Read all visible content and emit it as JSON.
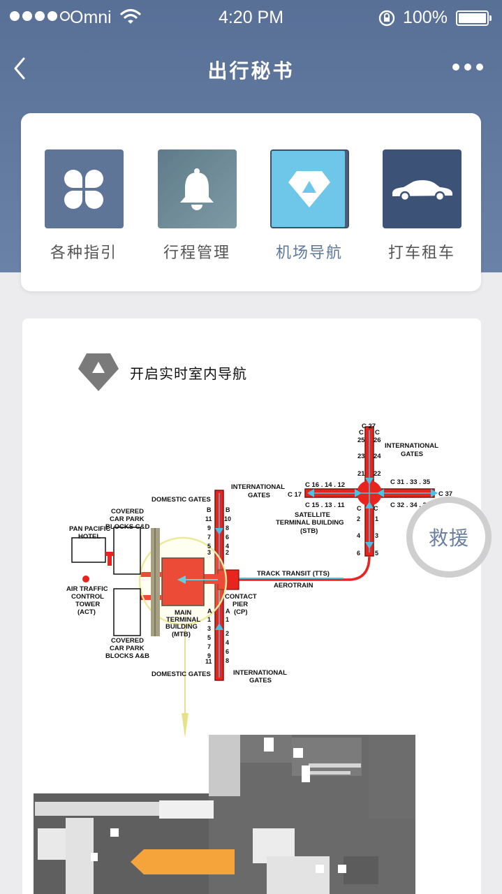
{
  "status_bar": {
    "carrier": "Omni",
    "time": "4:20 PM",
    "battery": "100%"
  },
  "nav": {
    "title": "出行秘书",
    "back_icon": "chevron-left-icon",
    "more_icon": "more-dots-icon"
  },
  "menu": [
    {
      "label": "各种指引",
      "icon": "clover-icon",
      "active": false
    },
    {
      "label": "行程管理",
      "icon": "bell-icon",
      "active": false
    },
    {
      "label": "机场导航",
      "icon": "diamond-icon",
      "active": true
    },
    {
      "label": "打车租车",
      "icon": "car-icon",
      "active": false
    }
  ],
  "indoor_nav": {
    "label": "开启实时室内导航",
    "icon": "diamond-icon"
  },
  "map": {
    "labels": {
      "c27": "C 27",
      "c25": "25",
      "c26": "26",
      "c23": "23",
      "c24": "24",
      "c21": "21",
      "c22": "22",
      "c_left": "C",
      "c_right": "C",
      "intl_gates_top": "INTERNATIONAL",
      "intl_gates_top2": "GATES",
      "c16": "C 16 . 14 . 12",
      "c17": "C 17",
      "c15": "C 15 . 13 . 11",
      "c31": "C 31 . 33 . 35",
      "c37": "C 37",
      "c32": "C 32 . 34 . 36",
      "satellite1": "SATELLITE",
      "satellite2": "TERMINAL BUILDING",
      "satellite3": "(STB)",
      "intl_mid1": "INTERNATIONAL",
      "intl_mid2": "GATES",
      "domestic_top": "DOMESTIC GATES",
      "covered_cd1": "COVERED",
      "covered_cd2": "CAR PARK",
      "covered_cd3": "BLOCKS C&D",
      "pan1": "PAN PACIFIC",
      "pan2": "HOTEL",
      "atc1": "AIR TRAFFIC",
      "atc2": "CONTROL",
      "atc3": "TOWER",
      "atc4": "(ACT)",
      "track": "TRACK TRANSIT (TTS)",
      "aerotrain": "AEROTRAIN",
      "contact1": "CONTACT",
      "contact2": "PIER",
      "contact3": "(CP)",
      "main1": "MAIN",
      "main2": "TERMINAL",
      "main3": "BUILDING",
      "main4": "(MTB)",
      "covered_ab1": "COVERED",
      "covered_ab2": "CAR PARK",
      "covered_ab3": "BLOCKS A&B",
      "domestic_bottom": "DOMESTIC GATES",
      "intl_bottom1": "INTERNATIONAL",
      "intl_bottom2": "GATES",
      "b_gates_left": [
        "B",
        "11",
        "9",
        "7",
        "5",
        "3"
      ],
      "b_gates_right": [
        "B",
        "10",
        "8",
        "6",
        "4",
        "2"
      ],
      "a_gates_left": [
        "A",
        "1",
        "3",
        "5",
        "7",
        "9",
        "11"
      ],
      "a_gates_right": [
        "A",
        "1",
        "2",
        "4",
        "6",
        "8",
        "10"
      ],
      "c_gates_left": [
        "2",
        "4",
        "6"
      ],
      "c_gates_right": [
        "1",
        "3",
        "5"
      ]
    }
  },
  "rescue_button": "救援",
  "colors": {
    "header": "#5f7597",
    "accent": "#6ec7e8",
    "terminal_red": "#e8241e",
    "active_text": "#5d7699"
  }
}
